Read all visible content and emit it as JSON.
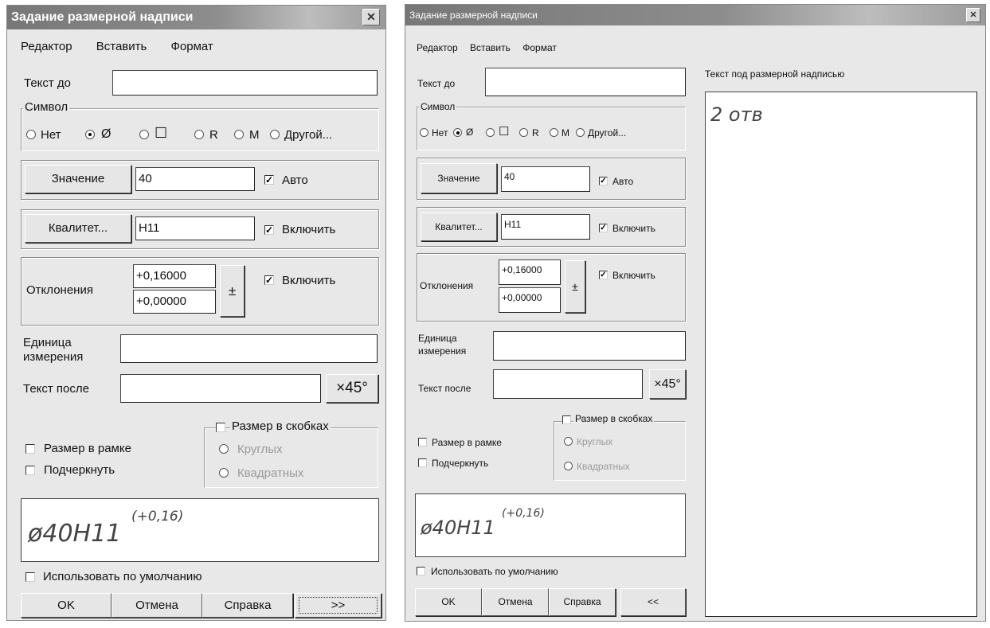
{
  "title": "Задание размерной надписи",
  "close_glyph": "✕",
  "menu": {
    "editor": "Редактор",
    "insert": "Вставить",
    "format": "Формат"
  },
  "fields": {
    "text_before_label": "Текст до",
    "text_before_value": "",
    "value_button": "Значение",
    "value": "40",
    "auto_label": "Авто",
    "qualitet_button": "Квалитет...",
    "qualitet_value": "H11",
    "qualitet_enable": "Включить",
    "deviations_label": "Отклонения",
    "dev_upper": "+0,16000",
    "dev_lower": "+0,00000",
    "dev_button": "±",
    "dev_enable": "Включить",
    "unit_label_1": "Единица",
    "unit_label_2": "измерения",
    "unit_value": "",
    "text_after_label": "Текст после",
    "text_after_value": "",
    "x45_button": "×45°"
  },
  "symbol": {
    "legend": "Символ",
    "none": "Нет",
    "diameter": "Ø",
    "square": "☐",
    "radius": "R",
    "metric": "M",
    "other": "Другой..."
  },
  "options": {
    "frame": "Размер в рамке",
    "underline": "Подчеркнуть",
    "brackets": "Размер в скобках",
    "round": "Круглых",
    "square_br": "Квадратных",
    "use_default": "Использовать по умолчанию"
  },
  "preview": {
    "main": "ø40H11",
    "sup": "(+0,16)"
  },
  "buttons": {
    "ok": "OK",
    "cancel": "Отмена",
    "help": "Справка",
    "more": ">>",
    "less": "<<"
  },
  "right_panel": {
    "label": "Текст под размерной надписью",
    "text": "2 отв"
  }
}
